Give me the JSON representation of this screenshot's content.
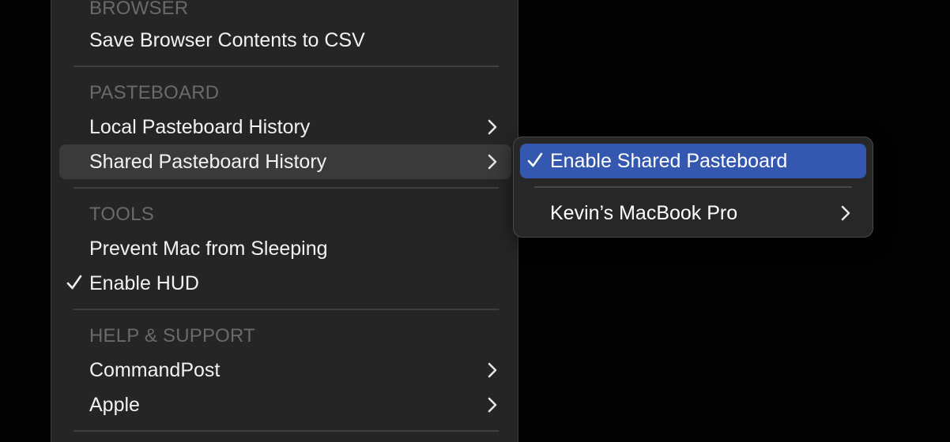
{
  "main_menu": {
    "sections": [
      {
        "header": "BROWSER"
      },
      {
        "header": "PASTEBOARD"
      },
      {
        "header": "TOOLS"
      },
      {
        "header": "HELP & SUPPORT"
      }
    ],
    "items": {
      "save_browser_csv": {
        "label": "Save Browser Contents to CSV"
      },
      "local_pasteboard_history": {
        "label": "Local Pasteboard History",
        "submenu": true
      },
      "shared_pasteboard_history": {
        "label": "Shared Pasteboard History",
        "submenu": true,
        "highlighted": true
      },
      "prevent_sleep": {
        "label": "Prevent Mac from Sleeping"
      },
      "enable_hud": {
        "label": "Enable HUD",
        "checked": true
      },
      "commandpost": {
        "label": "CommandPost",
        "submenu": true
      },
      "apple": {
        "label": "Apple",
        "submenu": true
      }
    }
  },
  "sub_menu": {
    "items": {
      "enable_shared_pasteboard": {
        "label": "Enable Shared Pasteboard",
        "checked": true,
        "selected": true
      },
      "kevins_macbook_pro": {
        "label": "Kevin’s MacBook Pro",
        "submenu": true
      }
    }
  },
  "colors": {
    "menu_background": "#252525",
    "highlight": "#3a3a3a",
    "selection_accent": "#3458b0",
    "text": "#f2f2f2",
    "section_header_text": "#6a6a6a",
    "separator": "#3f3f3f"
  }
}
